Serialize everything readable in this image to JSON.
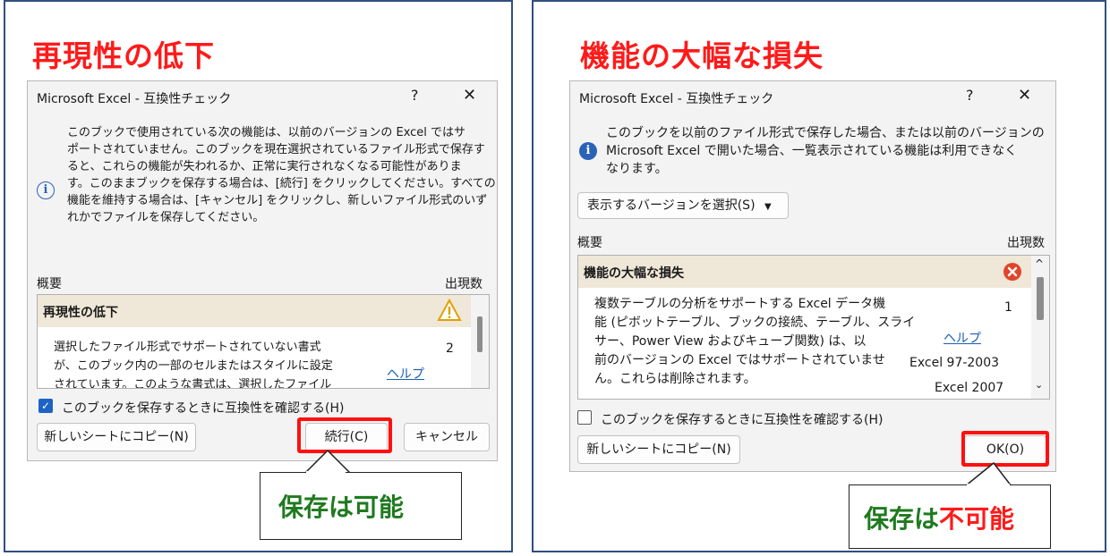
{
  "left": {
    "heading": "再現性の低下",
    "dialog": {
      "title": "Microsoft Excel - 互換性チェック",
      "help_glyph": "?",
      "close_glyph": "✕",
      "message_lines": [
        "このブックで使用されている次の機能は、以前のバージョンの Excel ではサ",
        "ポートされていません。このブックを現在選択されているファイル形式で保存す",
        "ると、これらの機能が失われるか、正常に実行されなくなる可能性がありま",
        "す。このままブックを保存する場合は、[続行] をクリックしてください。すべての",
        "機能を維持する場合は、[キャンセル] をクリックし、新しいファイル形式のいず",
        "れかでファイルを保存してください。"
      ],
      "summary_label": "概要",
      "occurrences_label": "出現数",
      "issue_header": "再現性の低下",
      "issue_lines": [
        "選択したファイル形式でサポートされていない書式",
        "が、このブック内の一部のセルまたはスタイルに設定",
        "されています。このような書式は、選択したファイル"
      ],
      "issue_count": "2",
      "help_link": "ヘルプ",
      "checkbox_label": "このブックを保存するときに互換性を確認する(H)",
      "checkbox_checked": true,
      "copy_button": "新しいシートにコピー(N)",
      "continue_button": "続行(C)",
      "cancel_button": "キャンセル"
    },
    "callout": {
      "part1": "保存は可能"
    }
  },
  "right": {
    "heading": "機能の大幅な損失",
    "dialog": {
      "title": "Microsoft Excel - 互換性チェック",
      "help_glyph": "?",
      "close_glyph": "✕",
      "message_lines": [
        "このブックを以前のファイル形式で保存した場合、または以前のバージョンの",
        "Microsoft Excel で開いた場合、一覧表示されている機能は利用できなく",
        "なります。"
      ],
      "version_select": "表示するバージョンを選択(S)",
      "summary_label": "概要",
      "occurrences_label": "出現数",
      "issue_header": "機能の大幅な損失",
      "issue_lines": [
        "複数テーブルの分析をサポートする Excel データ機",
        "能 (ピボットテーブル、ブックの接続、テーブル、スライ",
        "サー、Power View およびキューブ関数) は、以",
        "前のバージョンの Excel ではサポートされていませ",
        "ん。これらは削除されます。"
      ],
      "issue_count": "1",
      "help_link": "ヘルプ",
      "versions": [
        "Excel 97-2003",
        "Excel 2007"
      ],
      "checkbox_label": "このブックを保存するときに互換性を確認する(H)",
      "checkbox_checked": false,
      "copy_button": "新しいシートにコピー(N)",
      "ok_button": "OK(O)"
    },
    "callout": {
      "part1": "保存は",
      "part2": "不可能"
    }
  },
  "colors": {
    "heading_red": "#ff1a1a",
    "callout_green": "#1f7a1f",
    "highlight_red": "#ff1010",
    "accent_blue": "#1c63c5"
  }
}
